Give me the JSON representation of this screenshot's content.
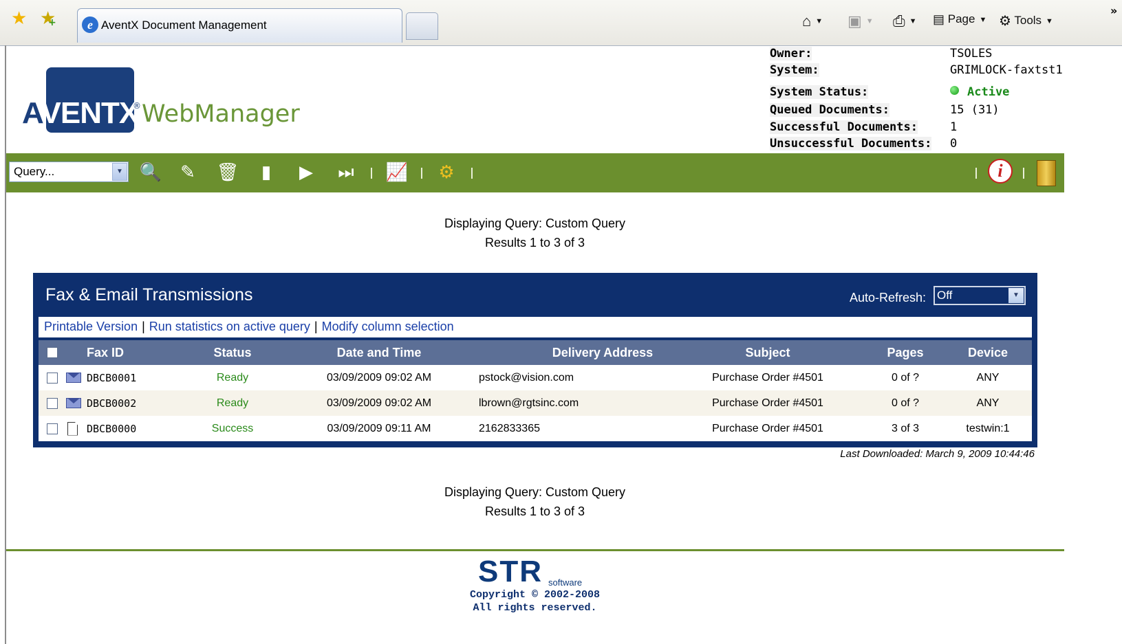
{
  "browser": {
    "tab_title": "AventX Document Management",
    "commands": {
      "page": "Page",
      "tools": "Tools"
    }
  },
  "header": {
    "logo": {
      "brand_a": "A",
      "brand_rest": "VENTX",
      "product": "WebManager"
    },
    "status": {
      "owner_label": "Owner:",
      "owner_value": "TSOLES",
      "system_label": "System:",
      "system_value": "GRIMLOCK-faxtst1",
      "system_status_label": "System Status:",
      "system_status_value": "Active",
      "queued_label": "Queued Documents:",
      "queued_value": "15 (31)",
      "successful_label": "Successful Documents:",
      "successful_value": "1",
      "unsuccessful_label": "Unsuccessful Documents:",
      "unsuccessful_value": "0"
    }
  },
  "toolbar": {
    "query_select": "Query...",
    "icons": [
      "search-icon",
      "edit-icon",
      "delete-icon",
      "view-document-icon",
      "next-document-icon",
      "forward-document-icon",
      "statistics-icon",
      "settings-icon",
      "info-icon",
      "exit-icon"
    ],
    "accent_color": "#6b8f2e"
  },
  "summary": {
    "query_text": "Displaying Query: Custom Query",
    "results_text": "Results 1 to 3 of 3"
  },
  "grid": {
    "title": "Fax & Email Transmissions",
    "auto_refresh_label": "Auto-Refresh:",
    "auto_refresh_value": "Off",
    "links": {
      "printable": "Printable Version",
      "statistics": "Run statistics on active query",
      "modify": "Modify column selection"
    },
    "columns": {
      "fax_id": "Fax ID",
      "status": "Status",
      "date_time": "Date and Time",
      "delivery_address": "Delivery Address",
      "subject": "Subject",
      "pages": "Pages",
      "device": "Device"
    },
    "rows": [
      {
        "icon": "envelope-icon",
        "fax_id": "DBCB0001",
        "status": "Ready",
        "date_time": "03/09/2009 09:02 AM",
        "delivery_address": "pstock@vision.com",
        "subject": "Purchase Order #4501",
        "pages": "0 of ?",
        "device": "ANY"
      },
      {
        "icon": "envelope-icon",
        "fax_id": "DBCB0002",
        "status": "Ready",
        "date_time": "03/09/2009 09:02 AM",
        "delivery_address": "lbrown@rgtsinc.com",
        "subject": "Purchase Order #4501",
        "pages": "0 of ?",
        "device": "ANY"
      },
      {
        "icon": "document-icon",
        "fax_id": "DBCB0000",
        "status": "Success",
        "date_time": "03/09/2009 09:11 AM",
        "delivery_address": "2162833365",
        "subject": "Purchase Order #4501",
        "pages": "3 of 3",
        "device": "testwin:1"
      }
    ],
    "last_downloaded": "Last Downloaded: March 9, 2009 10:44:46"
  },
  "footer": {
    "logo_big": "STR",
    "logo_small": "software",
    "copyright_line1": "Copyright © 2002-2008",
    "copyright_line2": "All rights reserved."
  }
}
